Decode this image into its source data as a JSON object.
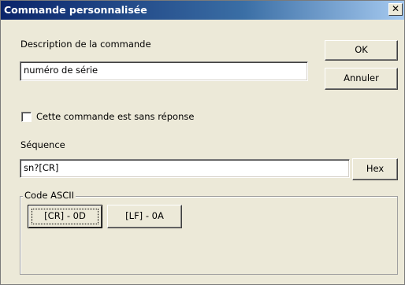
{
  "window": {
    "title": "Commande personnalisée",
    "close_glyph": "✕"
  },
  "description": {
    "label": "Description de la commande",
    "value": "numéro de série"
  },
  "buttons": {
    "ok": "OK",
    "cancel": "Annuler",
    "hex": "Hex"
  },
  "no_response": {
    "label": "Cette commande est sans réponse",
    "checked": false
  },
  "sequence": {
    "label": "Séquence",
    "value": "sn?[CR]"
  },
  "ascii": {
    "legend": "Code ASCII",
    "codes": [
      {
        "label": "[CR] - 0D"
      },
      {
        "label": "[LF] - 0A"
      }
    ]
  }
}
